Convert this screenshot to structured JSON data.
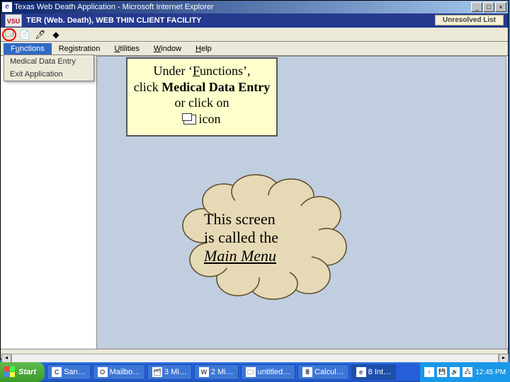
{
  "window": {
    "title": "Texas Web Death Application - Microsoft Internet Explorer",
    "controls": {
      "min": "_",
      "max": "□",
      "close": "×"
    }
  },
  "subtitle": {
    "app_abbrev": "VSU",
    "text": "TER (Web. Death), WEB THIN CLIENT FACILITY",
    "unresolved_label": "Unresolved List"
  },
  "menubar": {
    "items": [
      {
        "pre": "F",
        "ul": "u",
        "post": "nctions"
      },
      {
        "pre": "Re",
        "ul": "g",
        "post": "istration"
      },
      {
        "pre": "",
        "ul": "U",
        "post": "tilities"
      },
      {
        "pre": "",
        "ul": "W",
        "post": "indow"
      },
      {
        "pre": "",
        "ul": "H",
        "post": "elp"
      }
    ]
  },
  "dropdown": {
    "items": [
      "Medical Data Entry",
      "Exit Application"
    ]
  },
  "callout1": {
    "line1_a": "Under ‘",
    "line1_ul": "F",
    "line1_b": "unctions’,",
    "line2_a": "click ",
    "line2_b": "Medical Data Entry",
    "line2_c": " or click on",
    "line3": "icon"
  },
  "cloud": {
    "line1": "This screen",
    "line2": "is called the",
    "line3": "Main Menu"
  },
  "taskbar": {
    "start": "Start",
    "items": [
      {
        "icon": "C",
        "label": "San…"
      },
      {
        "icon": "O",
        "label": "Mailbo…"
      },
      {
        "icon": "🗂",
        "label": "3 Mi…"
      },
      {
        "icon": "W",
        "label": "2 Mi…"
      },
      {
        "icon": "🗀",
        "label": "untitled…"
      },
      {
        "icon": "🖩",
        "label": "Calcul…"
      },
      {
        "icon": "e",
        "label": "8 Int…"
      }
    ],
    "tray_icons": [
      "‹",
      "💾",
      "🔊",
      "🖧"
    ],
    "time": "12:45 PM"
  }
}
